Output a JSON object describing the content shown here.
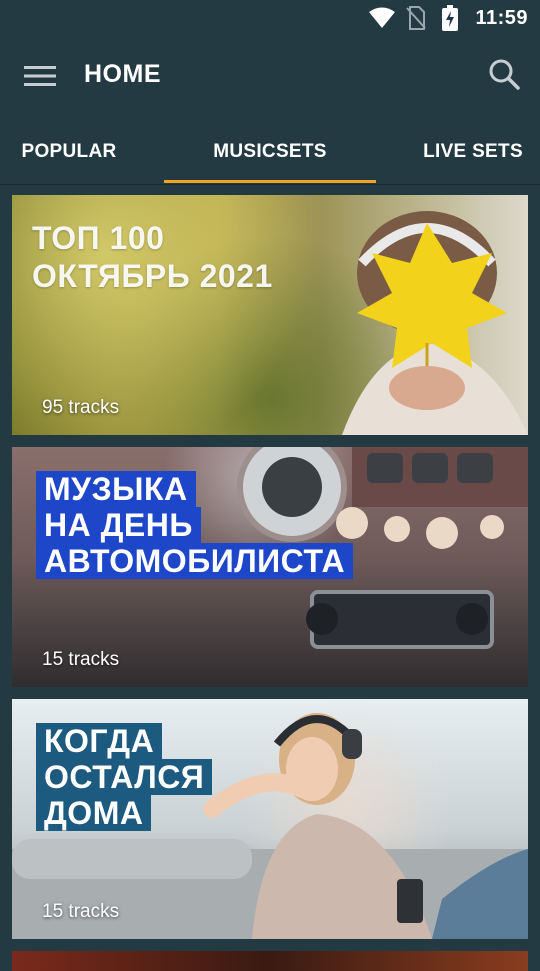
{
  "status_bar": {
    "time": "11:59"
  },
  "app_bar": {
    "title": "HOME"
  },
  "tabs": [
    {
      "label": "POPULAR"
    },
    {
      "label": "MUSICSETS"
    },
    {
      "label": "LIVE SETS"
    }
  ],
  "cards": [
    {
      "headline_lines": [
        "ТОП 100",
        "ОКТЯБРЬ 2021"
      ],
      "tracks": "95 tracks"
    },
    {
      "headline_lines": [
        "МУЗЫКА",
        "НА ДЕНЬ",
        "АВТОМОБИЛИСТА"
      ],
      "tracks": "15 tracks"
    },
    {
      "headline_lines": [
        "КОГДА",
        "ОСТАЛСЯ",
        "ДОМА"
      ],
      "tracks": "15 tracks"
    }
  ],
  "colors": {
    "background": "#243a43",
    "tab_indicator": "#f0a526",
    "banner_blue": "#1e46c9",
    "banner_teal": "#1c5a80"
  },
  "icons": [
    "wifi-icon",
    "no-sim-icon",
    "battery-charging-icon",
    "menu-icon",
    "search-icon"
  ]
}
